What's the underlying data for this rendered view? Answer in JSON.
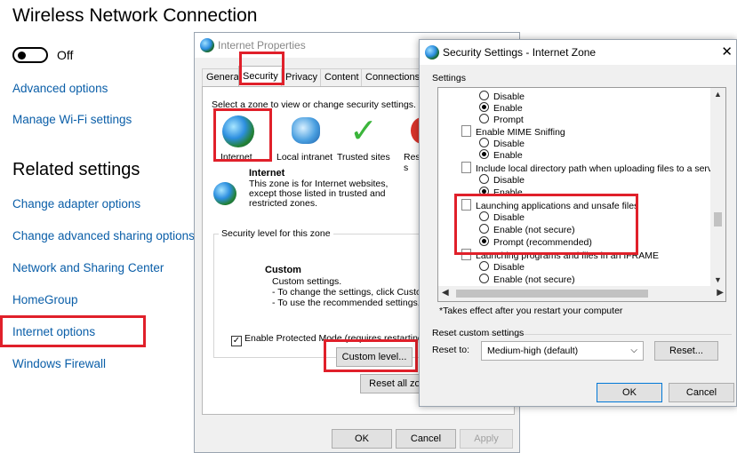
{
  "settings_page": {
    "title": "Wireless Network Connection",
    "toggle_label": "Off",
    "links": [
      "Advanced options",
      "Manage Wi-Fi settings"
    ],
    "related_heading": "Related settings",
    "related_links": [
      "Change adapter options",
      "Change advanced sharing options",
      "Network and Sharing Center",
      "HomeGroup",
      "Internet options",
      "Windows Firewall"
    ]
  },
  "internet_properties": {
    "title": "Internet Properties",
    "tabs": [
      "General",
      "Security",
      "Privacy",
      "Content",
      "Connections"
    ],
    "active_tab": "Security",
    "zone_prompt": "Select a zone to view or change security settings.",
    "zones": [
      "Internet",
      "Local intranet",
      "Trusted sites",
      "Res s"
    ],
    "zone_title": "Internet",
    "zone_desc": "This zone is for Internet websites, except those listed in trusted and restricted zones.",
    "security_level_label": "Security level for this zone",
    "custom_title": "Custom",
    "custom_lines": [
      "Custom settings.",
      "- To change the settings, click Custom",
      "- To use the recommended settings, c"
    ],
    "protected_mode": "Enable Protected Mode (requires restarting I",
    "custom_level_btn": "Custom level...",
    "reset_all_btn": "Reset all zone",
    "ok": "OK",
    "cancel": "Cancel",
    "apply": "Apply"
  },
  "security_settings": {
    "title": "Security Settings - Internet Zone",
    "settings_label": "Settings",
    "items": [
      {
        "kind": "radio",
        "label": "Disable",
        "on": false
      },
      {
        "kind": "radio",
        "label": "Enable",
        "on": true
      },
      {
        "kind": "radio",
        "label": "Prompt",
        "on": false
      },
      {
        "kind": "group",
        "label": "Enable MIME Sniffing"
      },
      {
        "kind": "radio",
        "label": "Disable",
        "on": false
      },
      {
        "kind": "radio",
        "label": "Enable",
        "on": true
      },
      {
        "kind": "group",
        "label": "Include local directory path when uploading files to a server"
      },
      {
        "kind": "radio",
        "label": "Disable",
        "on": false
      },
      {
        "kind": "radio",
        "label": "Enable",
        "on": true
      },
      {
        "kind": "group",
        "label": "Launching applications and unsafe files"
      },
      {
        "kind": "radio",
        "label": "Disable",
        "on": false
      },
      {
        "kind": "radio",
        "label": "Enable (not secure)",
        "on": false
      },
      {
        "kind": "radio",
        "label": "Prompt (recommended)",
        "on": true
      },
      {
        "kind": "group",
        "label": "Launching programs and files in an IFRAME"
      },
      {
        "kind": "radio",
        "label": "Disable",
        "on": false
      },
      {
        "kind": "radio",
        "label": "Enable (not secure)",
        "on": false
      }
    ],
    "footnote": "*Takes effect after you restart your computer",
    "reset_group": "Reset custom settings",
    "reset_to_label": "Reset to:",
    "reset_to_value": "Medium-high (default)",
    "reset_btn": "Reset...",
    "ok": "OK",
    "cancel": "Cancel"
  },
  "colors": {
    "link": "#0a5ea8",
    "highlight": "#e0202a"
  }
}
